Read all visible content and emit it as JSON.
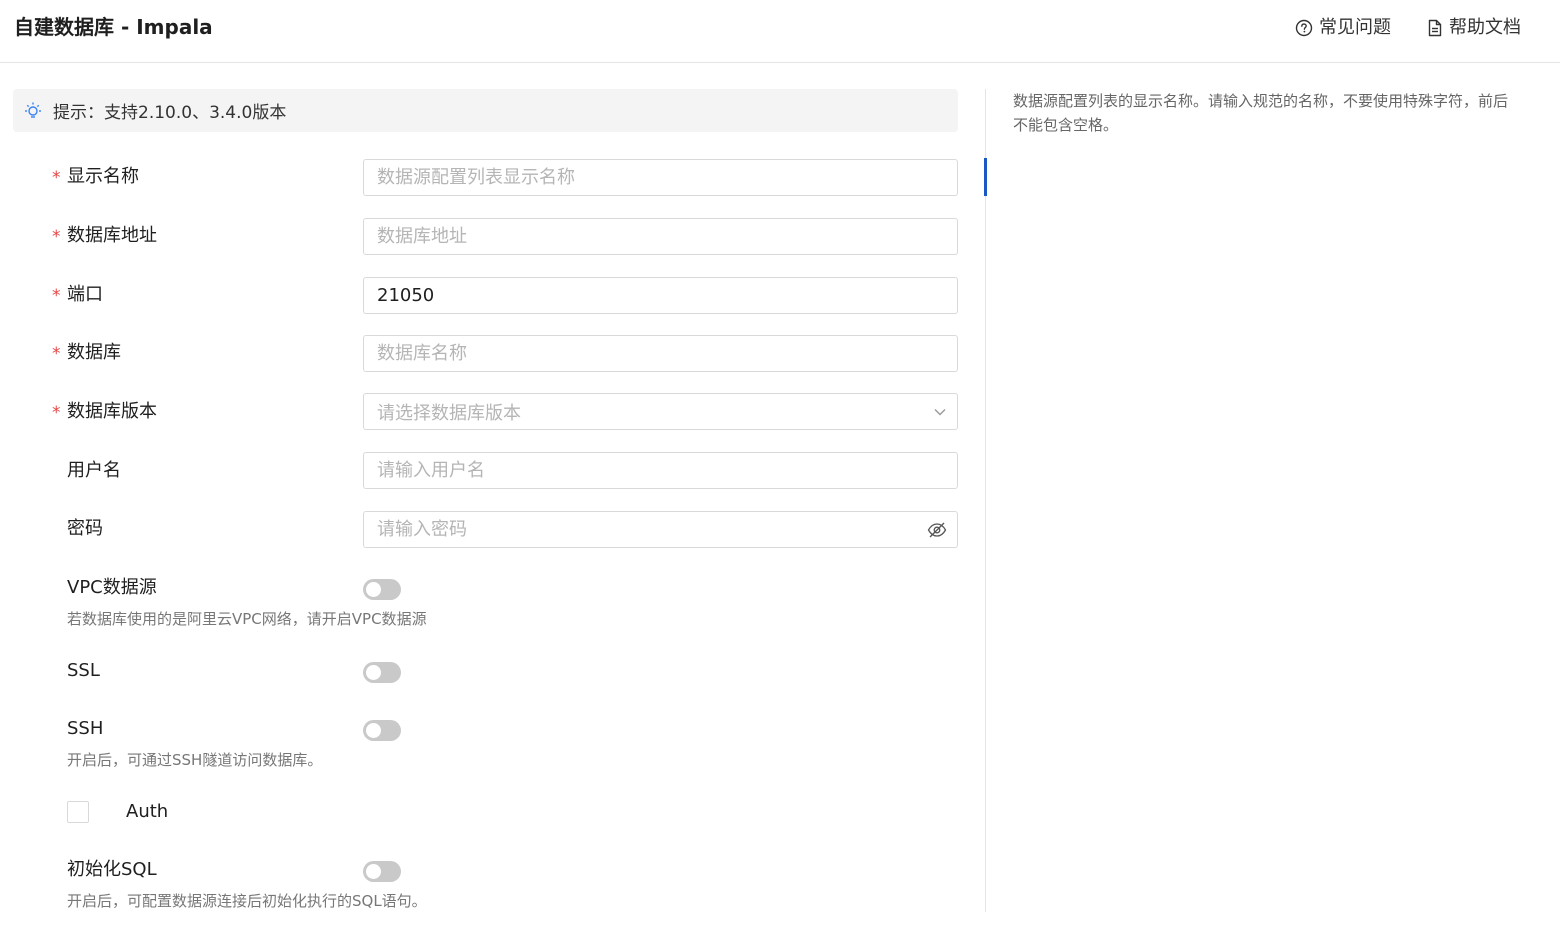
{
  "header": {
    "title": "自建数据库 - Impala",
    "faq_label": "常见问题",
    "docs_label": "帮助文档"
  },
  "tip": {
    "text": "提示：支持2.10.0、3.4.0版本"
  },
  "form": {
    "display_name": {
      "label": "显示名称",
      "required": "*",
      "placeholder": "数据源配置列表显示名称",
      "value": ""
    },
    "db_address": {
      "label": "数据库地址",
      "required": "*",
      "placeholder": "数据库地址",
      "value": ""
    },
    "port": {
      "label": "端口",
      "required": "*",
      "placeholder": "",
      "value": "21050"
    },
    "database": {
      "label": "数据库",
      "required": "*",
      "placeholder": "数据库名称",
      "value": ""
    },
    "db_version": {
      "label": "数据库版本",
      "required": "*",
      "placeholder": "请选择数据库版本"
    },
    "username": {
      "label": "用户名",
      "placeholder": "请输入用户名",
      "value": ""
    },
    "password": {
      "label": "密码",
      "placeholder": "请输入密码",
      "value": ""
    },
    "vpc": {
      "label": "VPC数据源",
      "hint": "若数据库使用的是阿里云VPC网络，请开启VPC数据源",
      "enabled": false
    },
    "ssl": {
      "label": "SSL",
      "enabled": false
    },
    "ssh": {
      "label": "SSH",
      "hint": "开启后，可通过SSH隧道访问数据库。",
      "enabled": false
    },
    "auth": {
      "label": "Auth",
      "checked": false
    },
    "init_sql": {
      "label": "初始化SQL",
      "hint": "开启后，可配置数据源连接后初始化执行的SQL语句。",
      "enabled": false
    }
  },
  "side_panel": {
    "help_text": "数据源配置列表的显示名称。请输入规范的名称，不要使用特殊字符，前后不能包含空格。"
  },
  "icons": {
    "faq": "question-circle-icon",
    "docs": "document-icon",
    "tip": "lightbulb-icon",
    "select": "chevron-down-icon",
    "password": "eye-slash-icon"
  },
  "colors": {
    "required": "#e54545",
    "switch_off": "#c9c9c9",
    "tip_background": "#f4f4f5",
    "tip_icon": "#3b82f6",
    "active_indicator": "#1b58c4"
  }
}
